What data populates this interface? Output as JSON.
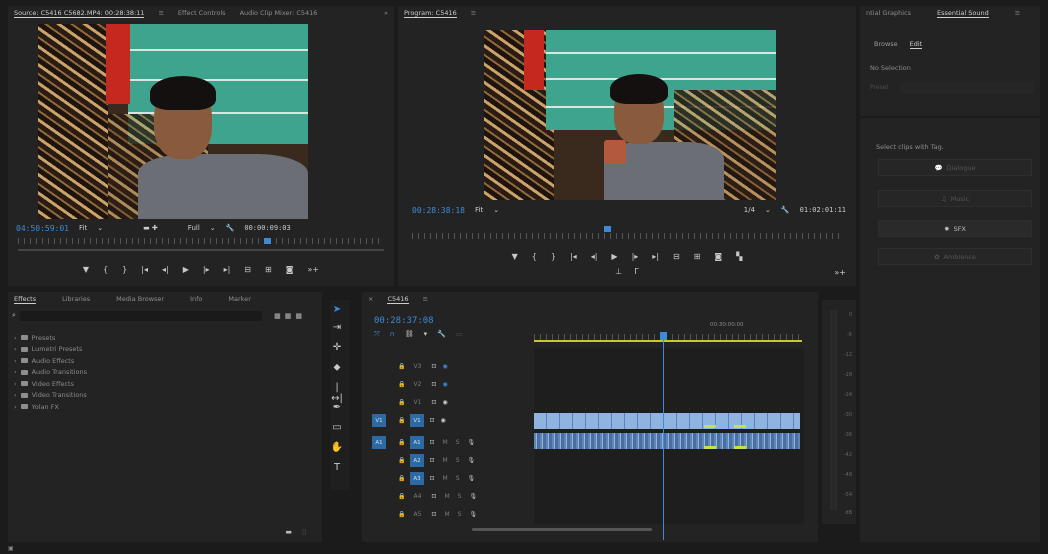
{
  "source_monitor": {
    "tabs": [
      "Source: C5416 C5682.MP4: 00:28:38:11",
      "Effect Controls",
      "Audio Clip Mixer: C5416"
    ],
    "menu_icon": "hamburger-icon",
    "more": "»",
    "timecode_current": "04:50:59:01",
    "fit": "Fit",
    "resolution": "Full",
    "duration": "00:00:09:03"
  },
  "program_monitor": {
    "title": "Program: C5416",
    "timecode_current": "00:28:38:18",
    "fit": "Fit",
    "resolution": "1/4",
    "duration": "01:02:01:11"
  },
  "essential_sound": {
    "tabs": [
      "ntial Graphics",
      "Essential Sound"
    ],
    "subtabs": [
      "Browse",
      "Edit"
    ],
    "no_selection": "No Selection",
    "preset_label": "Preset",
    "hint": "Select clips with Tag.",
    "buttons": [
      "Dialogue",
      "Music",
      "SFX",
      "Ambience"
    ],
    "active_button": "SFX"
  },
  "effects_panel": {
    "tabs": [
      "Effects",
      "Libraries",
      "Media Browser",
      "Info",
      "Marker"
    ],
    "search_placeholder": "",
    "items": [
      "Presets",
      "Lumetri Presets",
      "Audio Effects",
      "Audio Transitions",
      "Video Effects",
      "Video Transitions",
      "Yolan FX"
    ]
  },
  "timeline": {
    "sequence_name": "C5416",
    "timecode": "00:28:37:08",
    "ruler_label": "00:30:00:00",
    "video_tracks": [
      "V3",
      "V2",
      "V1"
    ],
    "audio_tracks": [
      "A1",
      "A2",
      "A3",
      "A4",
      "A5"
    ],
    "source_patch": [
      "V1",
      "A1"
    ],
    "track_toggles": {
      "mute": "M",
      "solo": "S"
    },
    "meter_labels": [
      "0",
      "-6",
      "-12",
      "-18",
      "-24",
      "-30",
      "-36",
      "-42",
      "-48",
      "-54",
      "dB"
    ]
  },
  "colors": {
    "accent": "#3d8bd8",
    "video_clip": "#8fb4e0",
    "audio_clip": "#5e86b8",
    "work_area": "#c8c827"
  }
}
